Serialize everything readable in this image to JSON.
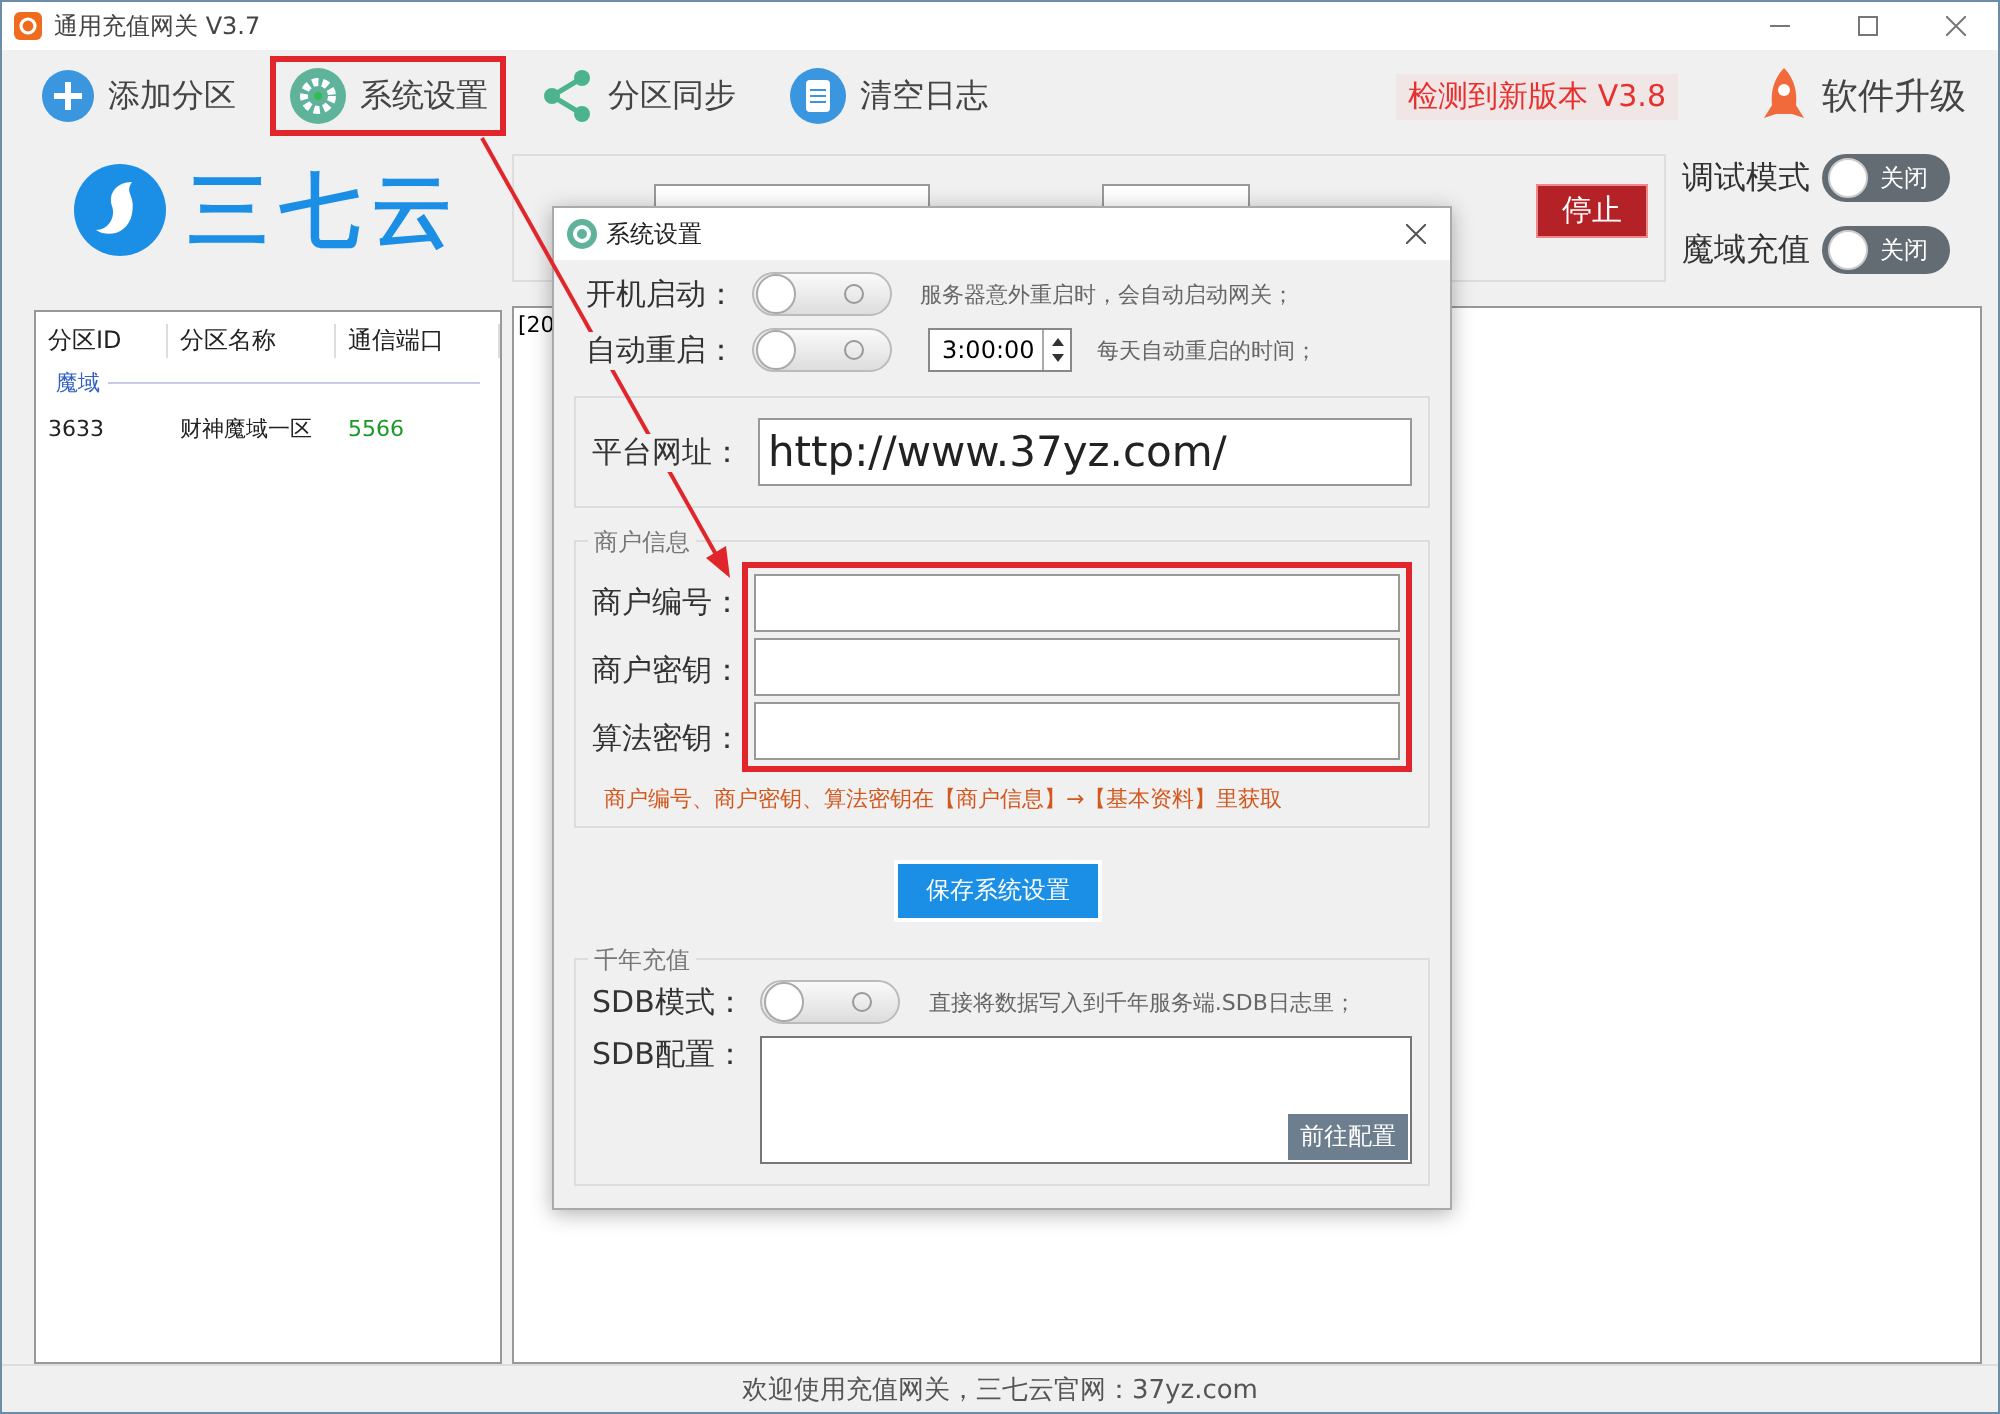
{
  "window": {
    "title": "通用充值网关 V3.7"
  },
  "toolbar": [
    {
      "kind": "add",
      "label": "添加分区",
      "highlighted": false
    },
    {
      "kind": "gear",
      "label": "系统设置",
      "highlighted": true
    },
    {
      "kind": "share",
      "label": "分区同步",
      "highlighted": false
    },
    {
      "kind": "doc",
      "label": "清空日志",
      "highlighted": false
    }
  ],
  "update_notice": "检测到新版本 V3.8",
  "upgrade_button": "软件升级",
  "logo": {
    "text": "三七云"
  },
  "stop_button": "停止",
  "switches": [
    {
      "label": "调试模式",
      "on": false,
      "state_text": "关闭"
    },
    {
      "label": "魔域充值",
      "on": false,
      "state_text": "关闭"
    }
  ],
  "partition_table": {
    "columns": [
      "分区ID",
      "分区名称",
      "通信端口"
    ],
    "groups": [
      {
        "name": "魔域",
        "rows": [
          {
            "id": "3633",
            "name": "财神魔域一区",
            "port": "5566"
          }
        ]
      }
    ]
  },
  "log": {
    "lines": [
      "[20"
    ]
  },
  "dialog": {
    "title": "系统设置",
    "startup": {
      "label": "开机启动：",
      "on": false,
      "hint": "服务器意外重启时，会自动启动网关；"
    },
    "restart": {
      "label": "自动重启：",
      "on": false,
      "time": "3:00:00",
      "hint": "每天自动重启的时间；"
    },
    "platform_url": {
      "label": "平台网址：",
      "value": "http://www.37yz.com/"
    },
    "merchant": {
      "title": "商户信息",
      "highlighted": true,
      "fields": [
        {
          "label": "商户编号："
        },
        {
          "label": "商户密钥："
        },
        {
          "label": "算法密钥："
        }
      ],
      "note": "商户编号、商户密钥、算法密钥在【商户信息】→【基本资料】里获取"
    },
    "save_button": "保存系统设置",
    "qiannian": {
      "title": "千年充值",
      "sdb_mode": {
        "label": "SDB模式：",
        "on": false,
        "hint": "直接将数据写入到千年服务端.SDB日志里；"
      },
      "sdb_config": {
        "label": "SDB配置：",
        "button": "前往配置"
      }
    }
  },
  "status_bar": {
    "text": "欢迎使用充值网关，三七云官网：37yz.com"
  }
}
